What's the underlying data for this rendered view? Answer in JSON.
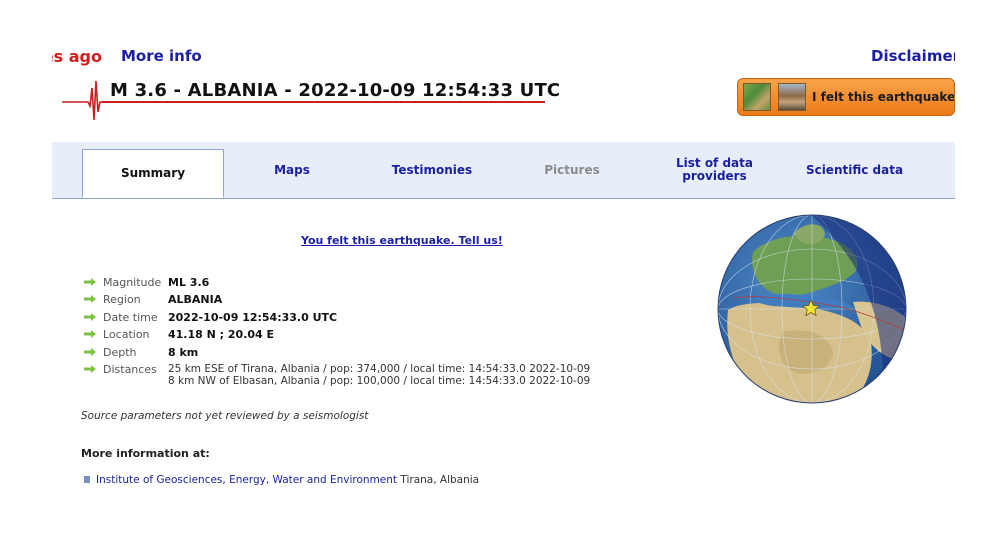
{
  "header": {
    "time_ago": "es ago",
    "more_info": "More info",
    "disclaimer": "Disclaimer",
    "title": "M 3.6 - ALBANIA - 2022-10-09 12:54:33 UTC",
    "felt_button": "I felt this earthquake"
  },
  "tabs": [
    {
      "label": "Summary",
      "state": "active"
    },
    {
      "label": "Maps",
      "state": "normal"
    },
    {
      "label": "Testimonies",
      "state": "normal"
    },
    {
      "label": "Pictures",
      "state": "disabled"
    },
    {
      "label": "List of data providers",
      "state": "normal"
    },
    {
      "label": "Scientific data",
      "state": "normal"
    }
  ],
  "summary": {
    "felt_link": "You felt this earthquake. Tell us!",
    "parameters": [
      {
        "label": "Magnitude",
        "value": "ML 3.6"
      },
      {
        "label": "Region",
        "value": "ALBANIA"
      },
      {
        "label": "Date time",
        "value": "2022-10-09 12:54:33.0 UTC"
      },
      {
        "label": "Location",
        "value": "41.18 N ; 20.04 E"
      },
      {
        "label": "Depth",
        "value": "8 km"
      }
    ],
    "distances_label": "Distances",
    "distances": [
      "25 km ESE of Tirana, Albania / pop: 374,000 / local time: 14:54:33.0 2022-10-09",
      "8 km NW of Elbasan, Albania / pop: 100,000 / local time: 14:54:33.0 2022-10-09"
    ],
    "source_note": "Source parameters not yet reviewed by a seismologist",
    "more_info_heading": "More information at:",
    "institute_link": "Institute of Geosciences, Energy, Water and Environment",
    "institute_location": " Tirana, Albania"
  },
  "icons": {
    "param_arrow": "green-arrow-icon",
    "epicenter": "star-icon",
    "logo": "seismogram-icon"
  },
  "colors": {
    "accent_blue": "#1b1fa3",
    "alert_red": "#d41d1d",
    "button_orange": "#ee7a18",
    "arrow_green": "#7cc242",
    "tabbar_bg": "#e7eefa"
  }
}
